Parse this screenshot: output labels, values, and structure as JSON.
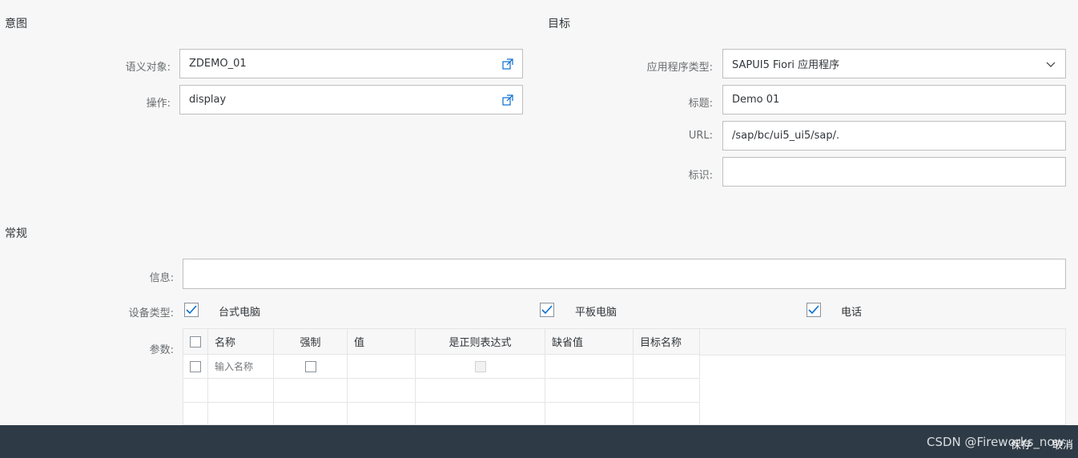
{
  "intent": {
    "title": "意图",
    "semantic_object_label": "语义对象:",
    "semantic_object_value": "ZDEMO_01",
    "action_label": "操作:",
    "action_value": "display"
  },
  "target": {
    "title": "目标",
    "app_type_label": "应用程序类型:",
    "app_type_value": "SAPUI5 Fiori 应用程序",
    "title_label": "标题:",
    "title_value": "Demo 01",
    "url_label": "URL:",
    "url_value": "/sap/bc/ui5_ui5/sap/.",
    "id_label": "标识:",
    "id_value": ""
  },
  "general": {
    "title": "常规",
    "info_label": "信息:",
    "info_value": "",
    "device_label": "设备类型:",
    "devices": [
      {
        "label": "台式电脑",
        "checked": true
      },
      {
        "label": "平板电脑",
        "checked": true
      },
      {
        "label": "电话",
        "checked": true
      }
    ],
    "params_label": "参数:",
    "params_columns": [
      "名称",
      "强制",
      "值",
      "是正则表达式",
      "缺省值",
      "目标名称"
    ],
    "params_name_placeholder": "输入名称"
  },
  "footer": {
    "save_label": "保存",
    "cancel_label": "取消",
    "watermark": "CSDN @Fireworks_now"
  },
  "colors": {
    "footer_bg": "#2e3a45",
    "accent": "#0a6ed1"
  }
}
